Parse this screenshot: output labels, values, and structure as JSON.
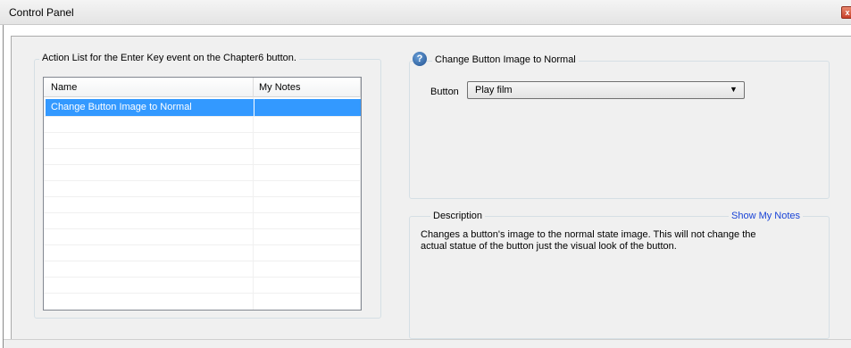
{
  "window": {
    "title": "Control Panel",
    "close_glyph": "x"
  },
  "action_list": {
    "legend": "Action List for the Enter Key event on the Chapter6 button.",
    "columns": [
      "Name",
      "My Notes"
    ],
    "rows": [
      {
        "name": "Change Button Image to Normal",
        "notes": "",
        "selected": true
      }
    ]
  },
  "action": {
    "help_icon": "?",
    "title": "Change Button Image to Normal",
    "button_label": "Button",
    "button_value": "Play film",
    "dropdown_arrow": "▼"
  },
  "description": {
    "legend": "Description",
    "show_notes_link": "Show My Notes",
    "text_line1": "Changes a button's image to the normal state image.  This will not change the",
    "text_line2": "actual statue of the button just the visual look of the button."
  },
  "colors": {
    "selection": "#3399ff",
    "link": "#1a44d6",
    "panel_bg": "#f0f0f0"
  }
}
